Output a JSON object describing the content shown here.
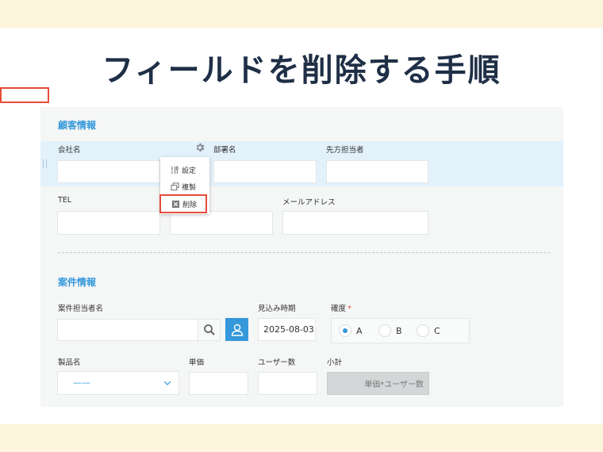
{
  "headline": "フィールドを削除する手順",
  "sections": {
    "customer": {
      "title": "顧客情報",
      "fields": {
        "company": "会社名",
        "department": "部署名",
        "contact": "先方担当者",
        "tel": "TEL",
        "email": "メールアドレス"
      }
    },
    "deal": {
      "title": "案件情報",
      "fields": {
        "assignee": "案件担当者名",
        "expected": "見込み時期",
        "expected_value": "2025-08-03",
        "certainty": "確度",
        "required_mark": "*",
        "product": "製品名",
        "product_value": "——",
        "unit_price": "単価",
        "users": "ユーザー数",
        "subtotal": "小計",
        "subtotal_formula": "単価*ユーザー数"
      },
      "radio_options": [
        "A",
        "B",
        "C"
      ],
      "radio_selected": "A"
    }
  },
  "context_menu": {
    "settings": "設定",
    "duplicate": "複製",
    "delete": "削除"
  },
  "icons": {
    "gear": "gear-icon",
    "settings": "tools-icon",
    "duplicate": "duplicate-icon",
    "delete": "delete-icon",
    "search": "search-icon",
    "user": "user-icon",
    "chevron": "chevron-down-icon"
  },
  "colors": {
    "accent": "#3498db",
    "danger": "#e74c3c",
    "headline": "#1f2f46",
    "band": "#fdf5dc"
  }
}
